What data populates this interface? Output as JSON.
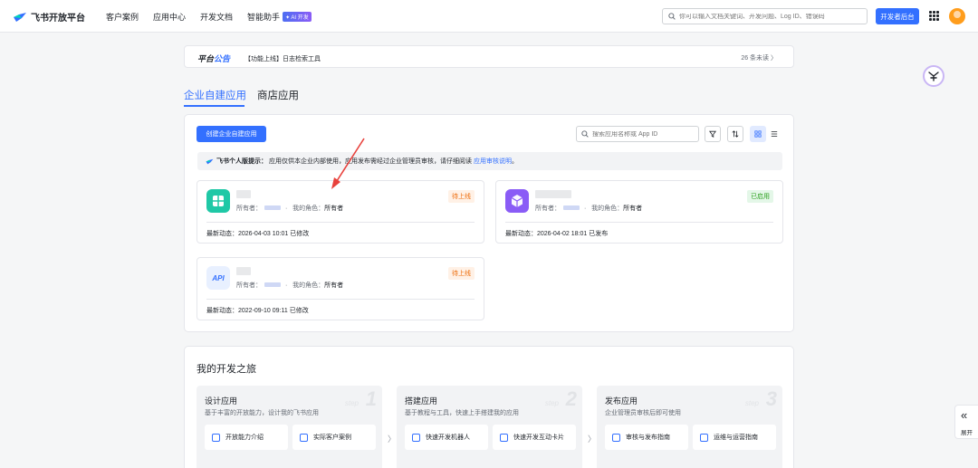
{
  "nav": {
    "logo_text": "飞书开放平台",
    "links": [
      "客户案例",
      "应用中心",
      "开发文档",
      "智能助手"
    ],
    "ai_badge": "✦ AI 开发",
    "search_placeholder": "你可以输入文档关键词、开发问题、Log ID、错误码",
    "dev_console_label": "开发者后台"
  },
  "announcement": {
    "label_a": "平台",
    "label_b": "公告",
    "text": "【功能上线】日志检索工具",
    "unread": "26 条未读 〉"
  },
  "tabs": {
    "enterprise": "企业自建应用",
    "store": "商店应用"
  },
  "apps_panel": {
    "create_label": "创建企业自建应用",
    "search_placeholder": "搜索应用名称或 App ID",
    "tip_title": "飞书个人版提示：",
    "tip_text": "应用仅供本企业内部使用，应用发布需经过企业管理员审核，请仔细阅读",
    "tip_link": "应用审核说明",
    "tip_end": "。",
    "cards": [
      {
        "owner_label": "所有者：",
        "role_label": "我的角色：",
        "role": "所有者",
        "status": "待上线",
        "footer": "最新动态：2026-04-03 10:01 已修改"
      },
      {
        "owner_label": "所有者：",
        "role_label": "我的角色：",
        "role": "所有者",
        "status": "已启用",
        "footer": "最新动态：2026-04-02 18:01 已发布"
      },
      {
        "owner_label": "所有者：",
        "role_label": "我的角色：",
        "role": "所有者",
        "status": "待上线",
        "footer": "最新动态：2022-09-10 09:11 已修改",
        "icon_text": "API"
      }
    ]
  },
  "journey": {
    "title": "我的开发之旅",
    "step_word": "step",
    "steps": [
      {
        "num": "1",
        "title": "设计应用",
        "desc": "基于丰富的开放能力，设计我的飞书应用",
        "items": [
          "开放能力介绍",
          "实际客户案例"
        ]
      },
      {
        "num": "2",
        "title": "搭建应用",
        "desc": "基于教程与工具，快速上手搭建我的应用",
        "items": [
          "快速开发机器人",
          "快速开发互动卡片"
        ]
      },
      {
        "num": "3",
        "title": "发布应用",
        "desc": "企业管理员审核后即可使用",
        "items": [
          "审核与发布指南",
          "运维与运营指南"
        ]
      }
    ],
    "arrow": "〉"
  },
  "side": {
    "expand_label": "展开",
    "expand_icon": "«"
  },
  "colors": {
    "primary": "#3370ff",
    "annotation_arrow": "#e8413c"
  }
}
